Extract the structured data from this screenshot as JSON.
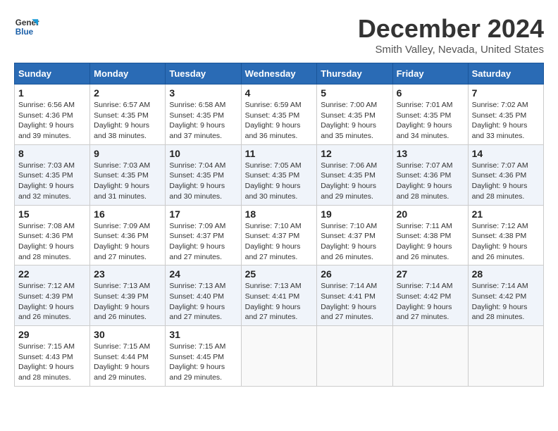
{
  "header": {
    "logo_line1": "General",
    "logo_line2": "Blue",
    "month_year": "December 2024",
    "location": "Smith Valley, Nevada, United States"
  },
  "calendar": {
    "days_of_week": [
      "Sunday",
      "Monday",
      "Tuesday",
      "Wednesday",
      "Thursday",
      "Friday",
      "Saturday"
    ],
    "weeks": [
      [
        {
          "day": "",
          "info": ""
        },
        {
          "day": "2",
          "info": "Sunrise: 6:57 AM\nSunset: 4:35 PM\nDaylight: 9 hours and 38 minutes."
        },
        {
          "day": "3",
          "info": "Sunrise: 6:58 AM\nSunset: 4:35 PM\nDaylight: 9 hours and 37 minutes."
        },
        {
          "day": "4",
          "info": "Sunrise: 6:59 AM\nSunset: 4:35 PM\nDaylight: 9 hours and 36 minutes."
        },
        {
          "day": "5",
          "info": "Sunrise: 7:00 AM\nSunset: 4:35 PM\nDaylight: 9 hours and 35 minutes."
        },
        {
          "day": "6",
          "info": "Sunrise: 7:01 AM\nSunset: 4:35 PM\nDaylight: 9 hours and 34 minutes."
        },
        {
          "day": "7",
          "info": "Sunrise: 7:02 AM\nSunset: 4:35 PM\nDaylight: 9 hours and 33 minutes."
        }
      ],
      [
        {
          "day": "1",
          "info": "Sunrise: 6:56 AM\nSunset: 4:36 PM\nDaylight: 9 hours and 39 minutes."
        },
        {
          "day": ""
        },
        {
          "day": ""
        },
        {
          "day": ""
        },
        {
          "day": ""
        },
        {
          "day": ""
        },
        {
          "day": ""
        }
      ],
      [
        {
          "day": "8",
          "info": "Sunrise: 7:03 AM\nSunset: 4:35 PM\nDaylight: 9 hours and 32 minutes."
        },
        {
          "day": "9",
          "info": "Sunrise: 7:03 AM\nSunset: 4:35 PM\nDaylight: 9 hours and 31 minutes."
        },
        {
          "day": "10",
          "info": "Sunrise: 7:04 AM\nSunset: 4:35 PM\nDaylight: 9 hours and 30 minutes."
        },
        {
          "day": "11",
          "info": "Sunrise: 7:05 AM\nSunset: 4:35 PM\nDaylight: 9 hours and 30 minutes."
        },
        {
          "day": "12",
          "info": "Sunrise: 7:06 AM\nSunset: 4:35 PM\nDaylight: 9 hours and 29 minutes."
        },
        {
          "day": "13",
          "info": "Sunrise: 7:07 AM\nSunset: 4:36 PM\nDaylight: 9 hours and 28 minutes."
        },
        {
          "day": "14",
          "info": "Sunrise: 7:07 AM\nSunset: 4:36 PM\nDaylight: 9 hours and 28 minutes."
        }
      ],
      [
        {
          "day": "15",
          "info": "Sunrise: 7:08 AM\nSunset: 4:36 PM\nDaylight: 9 hours and 28 minutes."
        },
        {
          "day": "16",
          "info": "Sunrise: 7:09 AM\nSunset: 4:36 PM\nDaylight: 9 hours and 27 minutes."
        },
        {
          "day": "17",
          "info": "Sunrise: 7:09 AM\nSunset: 4:37 PM\nDaylight: 9 hours and 27 minutes."
        },
        {
          "day": "18",
          "info": "Sunrise: 7:10 AM\nSunset: 4:37 PM\nDaylight: 9 hours and 27 minutes."
        },
        {
          "day": "19",
          "info": "Sunrise: 7:10 AM\nSunset: 4:37 PM\nDaylight: 9 hours and 26 minutes."
        },
        {
          "day": "20",
          "info": "Sunrise: 7:11 AM\nSunset: 4:38 PM\nDaylight: 9 hours and 26 minutes."
        },
        {
          "day": "21",
          "info": "Sunrise: 7:12 AM\nSunset: 4:38 PM\nDaylight: 9 hours and 26 minutes."
        }
      ],
      [
        {
          "day": "22",
          "info": "Sunrise: 7:12 AM\nSunset: 4:39 PM\nDaylight: 9 hours and 26 minutes."
        },
        {
          "day": "23",
          "info": "Sunrise: 7:13 AM\nSunset: 4:39 PM\nDaylight: 9 hours and 26 minutes."
        },
        {
          "day": "24",
          "info": "Sunrise: 7:13 AM\nSunset: 4:40 PM\nDaylight: 9 hours and 27 minutes."
        },
        {
          "day": "25",
          "info": "Sunrise: 7:13 AM\nSunset: 4:41 PM\nDaylight: 9 hours and 27 minutes."
        },
        {
          "day": "26",
          "info": "Sunrise: 7:14 AM\nSunset: 4:41 PM\nDaylight: 9 hours and 27 minutes."
        },
        {
          "day": "27",
          "info": "Sunrise: 7:14 AM\nSunset: 4:42 PM\nDaylight: 9 hours and 27 minutes."
        },
        {
          "day": "28",
          "info": "Sunrise: 7:14 AM\nSunset: 4:42 PM\nDaylight: 9 hours and 28 minutes."
        }
      ],
      [
        {
          "day": "29",
          "info": "Sunrise: 7:15 AM\nSunset: 4:43 PM\nDaylight: 9 hours and 28 minutes."
        },
        {
          "day": "30",
          "info": "Sunrise: 7:15 AM\nSunset: 4:44 PM\nDaylight: 9 hours and 29 minutes."
        },
        {
          "day": "31",
          "info": "Sunrise: 7:15 AM\nSunset: 4:45 PM\nDaylight: 9 hours and 29 minutes."
        },
        {
          "day": "",
          "info": ""
        },
        {
          "day": "",
          "info": ""
        },
        {
          "day": "",
          "info": ""
        },
        {
          "day": "",
          "info": ""
        }
      ]
    ]
  }
}
